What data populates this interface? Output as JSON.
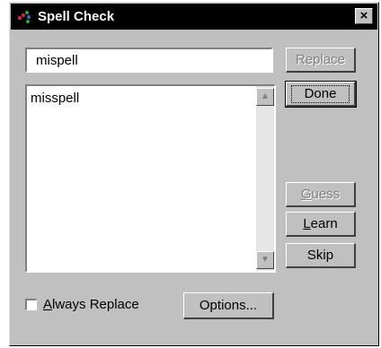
{
  "window": {
    "title": "Spell Check",
    "close_glyph": "×"
  },
  "icons": {
    "app": "spellcheck-app-icon",
    "close": "close-icon",
    "scroll_up": "scroll-up-arrow-icon",
    "scroll_down": "scroll-down-arrow-icon"
  },
  "word_input": {
    "value": "mispell"
  },
  "suggestions": [
    "misspell"
  ],
  "buttons": {
    "replace": "Replace",
    "done": "Done",
    "guess_rest": "uess",
    "guess_key": "G",
    "learn_key": "L",
    "learn_rest": "earn",
    "skip": "Skip",
    "options": "Options..."
  },
  "always_replace": {
    "key": "A",
    "rest": "lways Replace",
    "checked": false
  },
  "colors": {
    "face": "#c0c0c0",
    "titlebar": "#000000",
    "disabled_text": "#808080"
  }
}
